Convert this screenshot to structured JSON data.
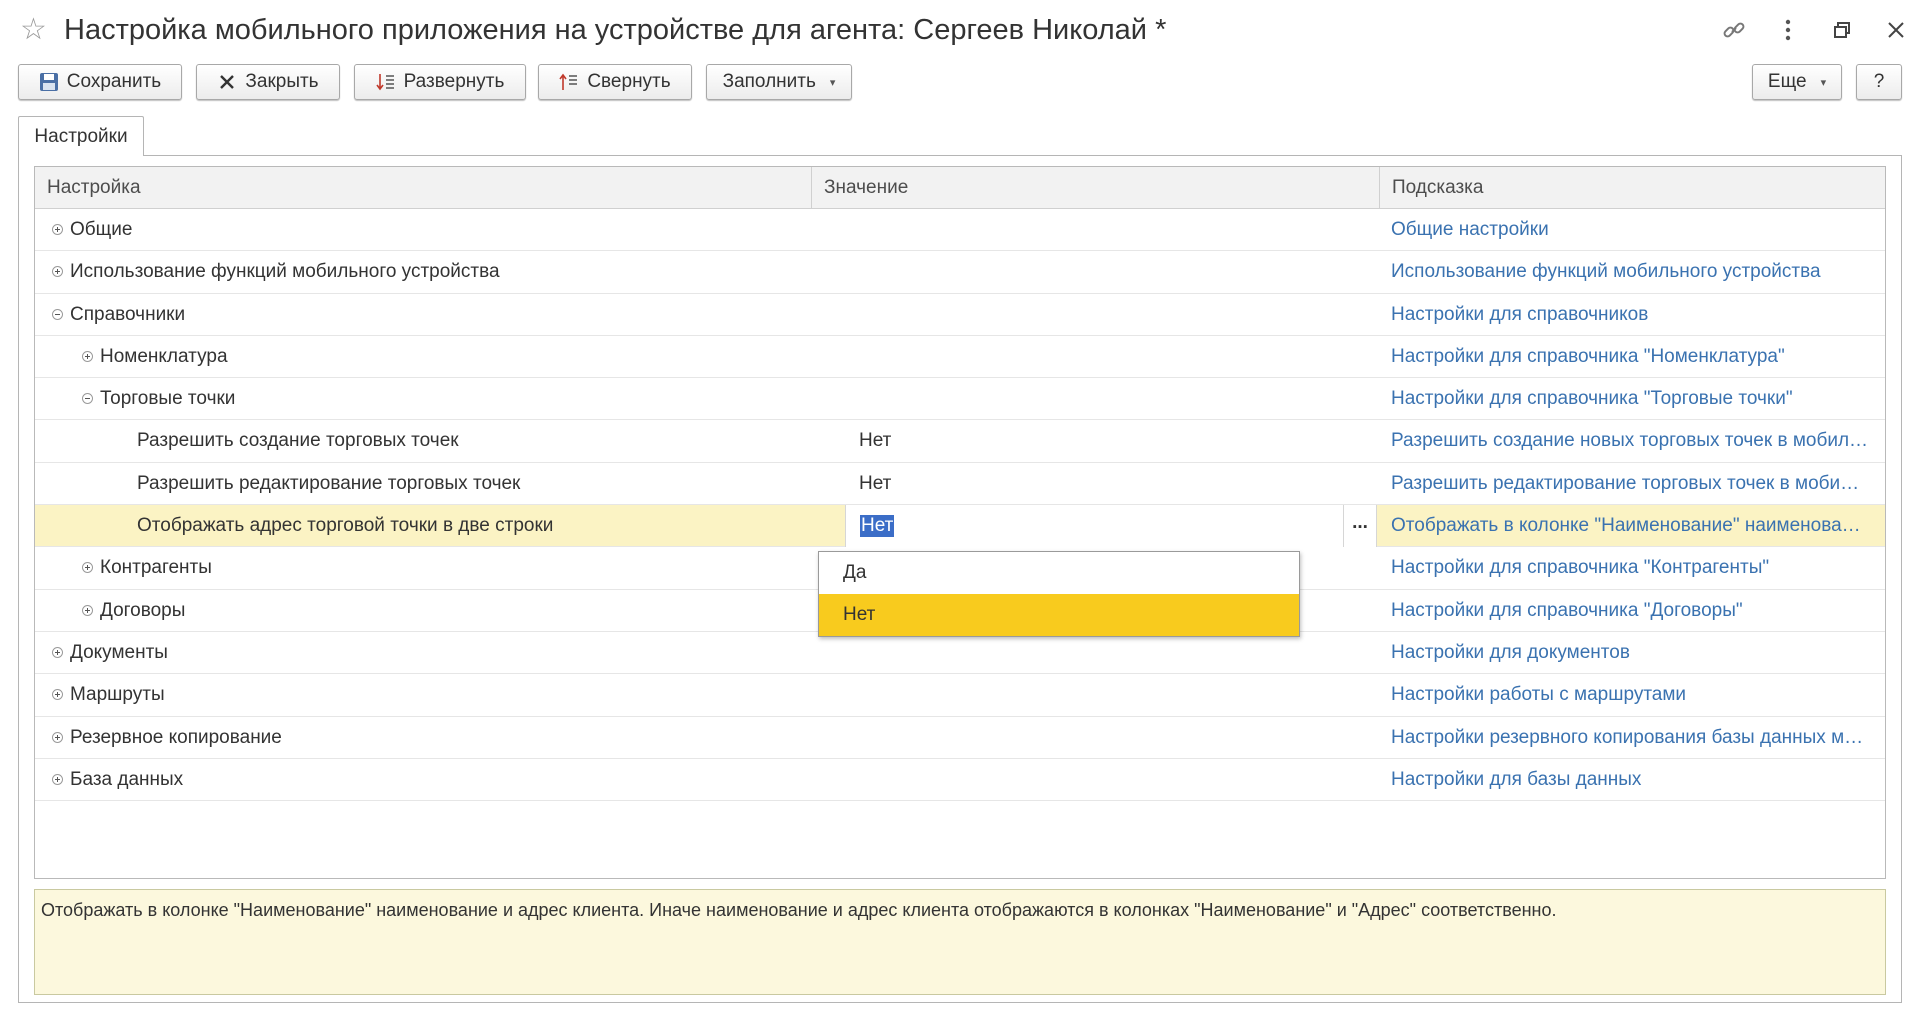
{
  "window": {
    "title": "Настройка мобильного приложения на устройстве для агента: Сергеев Николай *",
    "icons": [
      "star-icon",
      "link-icon",
      "more-vertical-icon",
      "restore-window-icon",
      "close-icon"
    ]
  },
  "toolbar": {
    "save_label": "Сохранить",
    "close_label": "Закрыть",
    "expand_label": "Развернуть",
    "collapse_label": "Свернуть",
    "fill_label": "Заполнить",
    "more_label": "Еще",
    "help_label": "?"
  },
  "tabs": [
    {
      "label": "Настройки",
      "active": true
    }
  ],
  "table": {
    "columns": {
      "setting": "Настройка",
      "value": "Значение",
      "hint": "Подсказка"
    },
    "rows": [
      {
        "name": "Общие",
        "value": "",
        "hint": "Общие настройки",
        "level": 0,
        "state": "collapsed"
      },
      {
        "name": "Использование функций мобильного устройства",
        "value": "",
        "hint": "Использование функций мобильного устройства",
        "level": 0,
        "state": "collapsed"
      },
      {
        "name": "Справочники",
        "value": "",
        "hint": "Настройки для справочников",
        "level": 0,
        "state": "expanded"
      },
      {
        "name": "Номенклатура",
        "value": "",
        "hint": "Настройки для справочника \"Номенклатура\"",
        "level": 1,
        "state": "collapsed"
      },
      {
        "name": "Торговые точки",
        "value": "",
        "hint": "Настройки для справочника \"Торговые точки\"",
        "level": 1,
        "state": "expanded"
      },
      {
        "name": "Разрешить создание торговых точек",
        "value": "Нет",
        "hint": "Разрешить создание новых торговых точек в мобильном приложении",
        "level": 2,
        "state": "leaf"
      },
      {
        "name": "Разрешить редактирование торговых точек",
        "value": "Нет",
        "hint": "Разрешить редактирование торговых точек в мобильном приложении",
        "level": 2,
        "state": "leaf"
      },
      {
        "name": "Отображать адрес торговой точки в две строки",
        "value": "Нет",
        "hint": "Отображать в колонке \"Наименование\" наименование и адрес клиента",
        "level": 2,
        "state": "leaf",
        "selected": true
      },
      {
        "name": "Контрагенты",
        "value": "",
        "hint": "Настройки для справочника \"Контрагенты\"",
        "level": 1,
        "state": "collapsed"
      },
      {
        "name": "Договоры",
        "value": "",
        "hint": "Настройки для справочника \"Договоры\"",
        "level": 1,
        "state": "collapsed"
      },
      {
        "name": "Документы",
        "value": "",
        "hint": "Настройки для документов",
        "level": 0,
        "state": "collapsed"
      },
      {
        "name": "Маршруты",
        "value": "",
        "hint": "Настройки работы с маршрутами",
        "level": 0,
        "state": "collapsed"
      },
      {
        "name": "Резервное копирование",
        "value": "",
        "hint": "Настройки резервного копирования базы данных мобильного приложения",
        "level": 0,
        "state": "collapsed"
      },
      {
        "name": "База данных",
        "value": "",
        "hint": "Настройки для базы данных",
        "level": 0,
        "state": "collapsed"
      }
    ],
    "edit_button": "..."
  },
  "dropdown": {
    "options": [
      "Да",
      "Нет"
    ],
    "selected": "Нет"
  },
  "hint_panel": {
    "text": "Отображать в колонке \"Наименование\" наименование и адрес клиента. Иначе наименование и адрес клиента отображаются в колонках \"Наименование\" и \"Адрес\" соответственно."
  },
  "colors": {
    "selected_row": "#fbf3c4",
    "dropdown_active": "#f8cb1e",
    "hint_link": "#3a72b0",
    "hint_panel_bg": "#fcf8dd"
  }
}
